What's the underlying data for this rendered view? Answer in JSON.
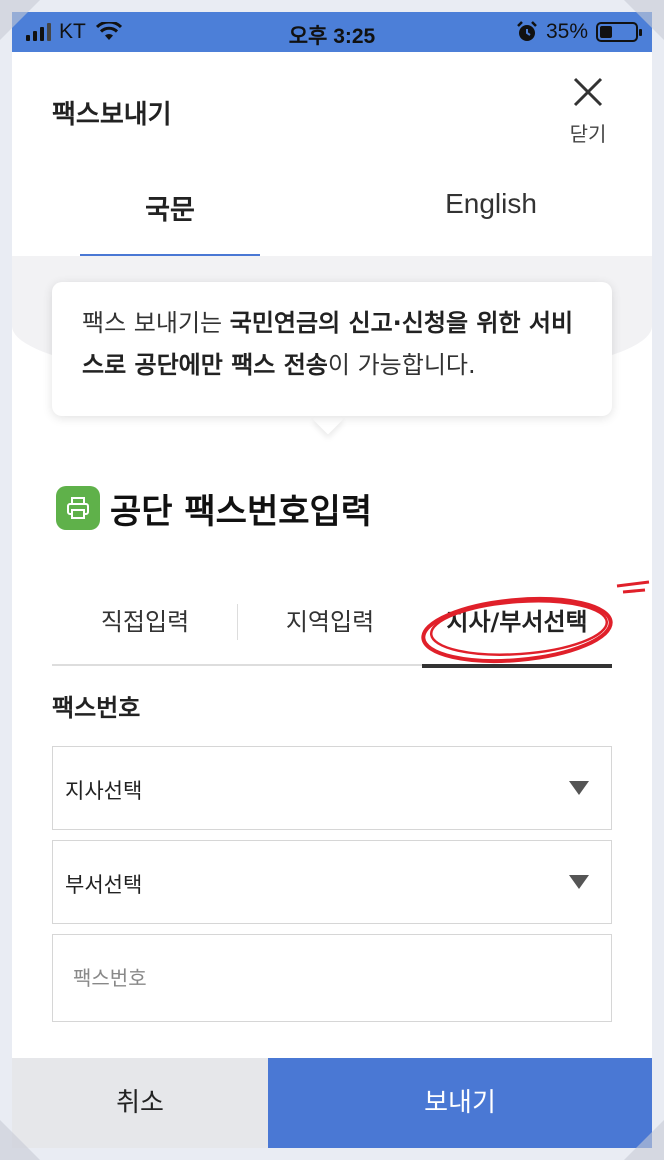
{
  "status_bar": {
    "carrier": "KT",
    "time": "오후 3:25",
    "battery_percent": "35%"
  },
  "header": {
    "title": "팩스보내기",
    "close_label": "닫기"
  },
  "language_tabs": [
    {
      "label": "국문",
      "selected": true
    },
    {
      "label": "English",
      "selected": false
    }
  ],
  "notice": {
    "part1": "팩스 보내기는 ",
    "bold1": "국민연금의 신고·신청을 위한 서비스로 공단에만 팩스 전송",
    "part2": "이 가능합니다."
  },
  "section": {
    "title": "공단 팩스번호입력",
    "icon": "printer-icon"
  },
  "mode_tabs": [
    {
      "label": "직접입력",
      "selected": false
    },
    {
      "label": "지역입력",
      "selected": false
    },
    {
      "label": "지사/부서선택",
      "selected": true
    }
  ],
  "fax": {
    "label": "팩스번호",
    "branch_select": "지사선택",
    "department_select": "부서선택",
    "number_placeholder": "팩스번호"
  },
  "buttons": {
    "cancel": "취소",
    "send": "보내기"
  },
  "colors": {
    "accent": "#4a78d4",
    "status_bar": "#4c7fd8",
    "icon_green": "#5fb14a",
    "annotation_red": "#e0202a"
  }
}
